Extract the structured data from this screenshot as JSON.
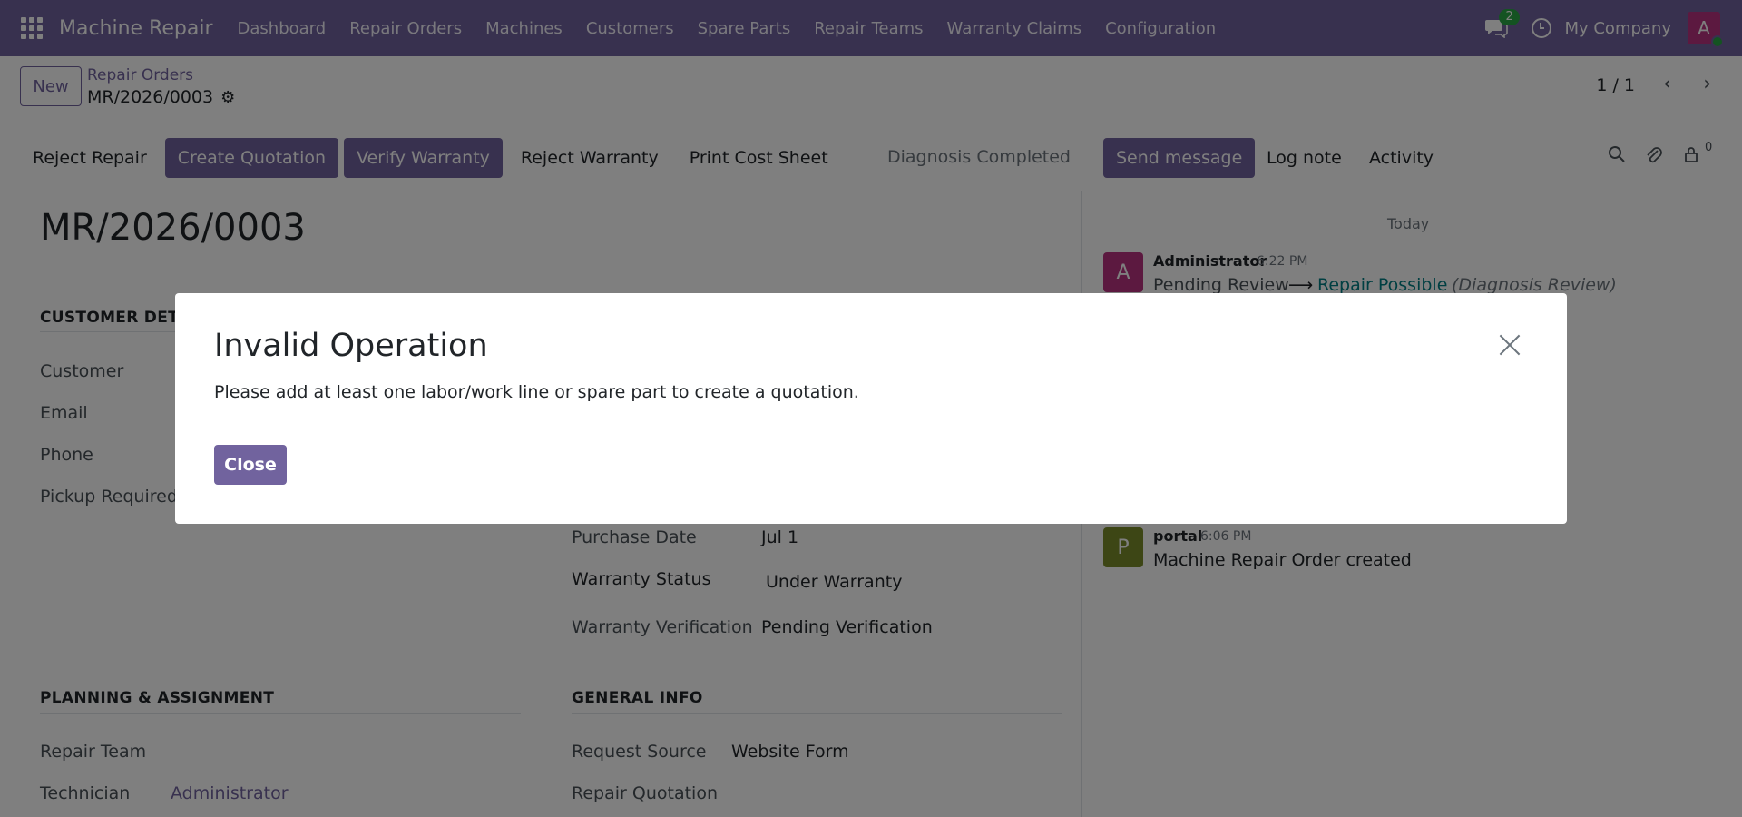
{
  "navbar": {
    "app_name": "Machine Repair",
    "menu": [
      "Dashboard",
      "Repair Orders",
      "Machines",
      "Customers",
      "Spare Parts",
      "Repair Teams",
      "Warranty Claims",
      "Configuration"
    ],
    "chat_count": "2",
    "company": "My Company",
    "avatar_letter": "A"
  },
  "control_panel": {
    "new_label": "New",
    "breadcrumb_parent": "Repair Orders",
    "breadcrumb_current": "MR/2026/0003",
    "pager": "1 / 1"
  },
  "statusbar": {
    "buttons": [
      "Reject Repair",
      "Create Quotation",
      "Verify Warranty",
      "Reject Warranty",
      "Print Cost Sheet"
    ],
    "stage": "Diagnosis Completed"
  },
  "form": {
    "title": "MR/2026/0003",
    "customer_section": "CUSTOMER DETAILS",
    "customer_labels": [
      "Customer",
      "Email",
      "Phone",
      "Pickup Required"
    ],
    "purchase_date_label": "Purchase Date",
    "purchase_date_value": "Jul 1",
    "warranty_status_label": "Warranty Status",
    "warranty_status_value": "Under Warranty",
    "warranty_verification_label": "Warranty Verification",
    "warranty_verification_value": "Pending Verification",
    "planning_section": "PLANNING & ASSIGNMENT",
    "repair_team_label": "Repair Team",
    "technician_label": "Technician",
    "technician_value": "Administrator",
    "general_section": "GENERAL INFO",
    "request_source_label": "Request Source",
    "request_source_value": "Website Form",
    "repair_quotation_label": "Repair Quotation"
  },
  "chatter": {
    "send_message": "Send message",
    "log_note": "Log note",
    "activity": "Activity",
    "follower_count": "0",
    "today": "Today",
    "messages": [
      {
        "avatar": "A",
        "author": "Administrator",
        "time": "6:22 PM",
        "from": "Pending Review",
        "arrow": "⟶",
        "to": "Repair Possible",
        "field": "(Diagnosis Review)"
      },
      {
        "avatar": "P",
        "author": "portal",
        "time": "6:06 PM",
        "body": "Machine Repair Order created"
      }
    ]
  },
  "modal": {
    "title": "Invalid Operation",
    "body": "Please add at least one labor/work line or spare part to create a quotation.",
    "close_label": "Close"
  },
  "colors": {
    "brand": "#71639e",
    "avatar_admin": "#b83280",
    "avatar_portal": "#7b8c2a"
  }
}
